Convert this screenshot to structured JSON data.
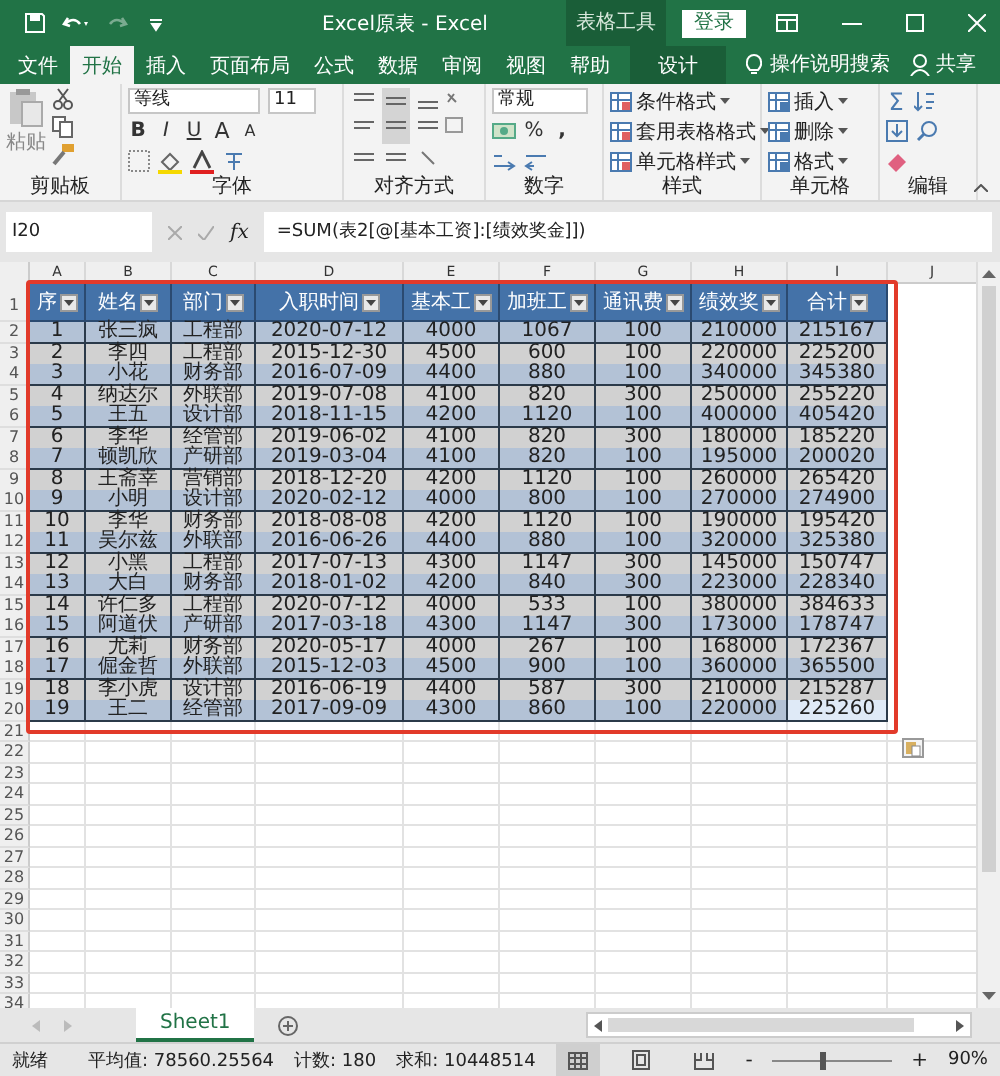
{
  "title_bar": {
    "title": "Excel原表  -  Excel",
    "context_label": "表格工具",
    "sign_in": "登录"
  },
  "tabs": [
    {
      "label": "文件",
      "selected": false,
      "kind": "normal"
    },
    {
      "label": "开始",
      "selected": true,
      "kind": "normal"
    },
    {
      "label": "插入",
      "selected": false,
      "kind": "normal"
    },
    {
      "label": "页面布局",
      "selected": false,
      "kind": "normal"
    },
    {
      "label": "公式",
      "selected": false,
      "kind": "normal"
    },
    {
      "label": "数据",
      "selected": false,
      "kind": "normal"
    },
    {
      "label": "审阅",
      "selected": false,
      "kind": "normal"
    },
    {
      "label": "视图",
      "selected": false,
      "kind": "normal"
    },
    {
      "label": "帮助",
      "selected": false,
      "kind": "normal"
    },
    {
      "label": "设计",
      "selected": false,
      "kind": "contextual"
    }
  ],
  "tell_me": "操作说明搜索",
  "share": "共享",
  "ribbon": [
    {
      "kind": "clipboard",
      "label": "剪贴板",
      "paste": "粘贴"
    },
    {
      "kind": "font",
      "label": "字体",
      "font": "等线",
      "size": "11",
      "bold": "B",
      "italic": "I",
      "underline": "U",
      "grow": "A",
      "shrink": "A"
    },
    {
      "kind": "align",
      "label": "对齐方式"
    },
    {
      "kind": "number",
      "label": "数字",
      "format": "常规",
      "percent": "%",
      "comma": ","
    },
    {
      "kind": "styles",
      "label": "样式",
      "items": [
        "条件格式",
        "套用表格格式",
        "单元格样式"
      ]
    },
    {
      "kind": "cells",
      "label": "单元格",
      "items": [
        "插入",
        "删除",
        "格式"
      ]
    },
    {
      "kind": "editing",
      "label": "编辑",
      "sum": "Σ"
    }
  ],
  "formula_bar": {
    "name_box": "I20",
    "fx": "fx",
    "formula": "=SUM(表2[@[基本工资]:[绩效奖金]])"
  },
  "column_letters": [
    "A",
    "B",
    "C",
    "D",
    "E",
    "F",
    "G",
    "H",
    "I",
    "J"
  ],
  "row_numbers": [
    "1",
    "2",
    "3",
    "4",
    "5",
    "6",
    "7",
    "8",
    "9",
    "10",
    "11",
    "12",
    "13",
    "14",
    "15",
    "16",
    "17",
    "18",
    "19",
    "20",
    "21",
    "22",
    "23",
    "24",
    "25",
    "26",
    "27",
    "28",
    "29",
    "30",
    "31",
    "32",
    "33",
    "34"
  ],
  "table": {
    "headers": [
      "序",
      "姓名",
      "部门",
      "入职时间",
      "基本工",
      "加班工",
      "通讯费",
      "绩效奖",
      "合计"
    ],
    "rows": [
      {
        "cells": [
          "1",
          "张三疯",
          "工程部",
          "2020-07-12",
          "4000",
          "1067",
          "100",
          "210000",
          "215167"
        ],
        "total_selected": false
      },
      {
        "cells": [
          "2",
          "李四",
          "工程部",
          "2015-12-30",
          "4500",
          "600",
          "100",
          "220000",
          "225200"
        ],
        "total_selected": false
      },
      {
        "cells": [
          "3",
          "小花",
          "财务部",
          "2016-07-09",
          "4400",
          "880",
          "100",
          "340000",
          "345380"
        ],
        "total_selected": false
      },
      {
        "cells": [
          "4",
          "纳达尔",
          "外联部",
          "2019-07-08",
          "4100",
          "820",
          "300",
          "250000",
          "255220"
        ],
        "total_selected": false
      },
      {
        "cells": [
          "5",
          "王五",
          "设计部",
          "2018-11-15",
          "4200",
          "1120",
          "100",
          "400000",
          "405420"
        ],
        "total_selected": false
      },
      {
        "cells": [
          "6",
          "李华",
          "经管部",
          "2019-06-02",
          "4100",
          "820",
          "300",
          "180000",
          "185220"
        ],
        "total_selected": false
      },
      {
        "cells": [
          "7",
          "顿凯欣",
          "产研部",
          "2019-03-04",
          "4100",
          "820",
          "100",
          "195000",
          "200020"
        ],
        "total_selected": false
      },
      {
        "cells": [
          "8",
          "王斋幸",
          "营销部",
          "2018-12-20",
          "4200",
          "1120",
          "100",
          "260000",
          "265420"
        ],
        "total_selected": false
      },
      {
        "cells": [
          "9",
          "小明",
          "设计部",
          "2020-02-12",
          "4000",
          "800",
          "100",
          "270000",
          "274900"
        ],
        "total_selected": false
      },
      {
        "cells": [
          "10",
          "李华",
          "财务部",
          "2018-08-08",
          "4200",
          "1120",
          "100",
          "190000",
          "195420"
        ],
        "total_selected": false
      },
      {
        "cells": [
          "11",
          "吴尔兹",
          "外联部",
          "2016-06-26",
          "4400",
          "880",
          "100",
          "320000",
          "325380"
        ],
        "total_selected": false
      },
      {
        "cells": [
          "12",
          "小黑",
          "工程部",
          "2017-07-13",
          "4300",
          "1147",
          "300",
          "145000",
          "150747"
        ],
        "total_selected": false
      },
      {
        "cells": [
          "13",
          "大白",
          "财务部",
          "2018-01-02",
          "4200",
          "840",
          "300",
          "223000",
          "228340"
        ],
        "total_selected": false
      },
      {
        "cells": [
          "14",
          "许仁多",
          "工程部",
          "2020-07-12",
          "4000",
          "533",
          "100",
          "380000",
          "384633"
        ],
        "total_selected": false
      },
      {
        "cells": [
          "15",
          "阿道伏",
          "产研部",
          "2017-03-18",
          "4300",
          "1147",
          "300",
          "173000",
          "178747"
        ],
        "total_selected": false
      },
      {
        "cells": [
          "16",
          "尤莉",
          "财务部",
          "2020-05-17",
          "4000",
          "267",
          "100",
          "168000",
          "172367"
        ],
        "total_selected": false
      },
      {
        "cells": [
          "17",
          "倔金哲",
          "外联部",
          "2015-12-03",
          "4500",
          "900",
          "100",
          "360000",
          "365500"
        ],
        "total_selected": false
      },
      {
        "cells": [
          "18",
          "李小虎",
          "设计部",
          "2016-06-19",
          "4400",
          "587",
          "300",
          "210000",
          "215287"
        ],
        "total_selected": false
      },
      {
        "cells": [
          "19",
          "王二",
          "经管部",
          "2017-09-09",
          "4300",
          "860",
          "100",
          "220000",
          "225260"
        ],
        "total_selected": true
      }
    ]
  },
  "sheet_tabs": [
    {
      "label": "Sheet1",
      "selected": true
    }
  ],
  "status_bar": {
    "ready": "就绪",
    "average": "平均值: 78560.25564",
    "count": "计数: 180",
    "sum": "求和: 10448514",
    "views": [
      {
        "kind": "normal",
        "selected": true
      },
      {
        "kind": "page_layout",
        "selected": false
      },
      {
        "kind": "page_break",
        "selected": false
      }
    ],
    "zoom_out": "-",
    "zoom_in": "+",
    "zoom": {
      "level": 0.42
    },
    "zoom_text": "90%"
  }
}
